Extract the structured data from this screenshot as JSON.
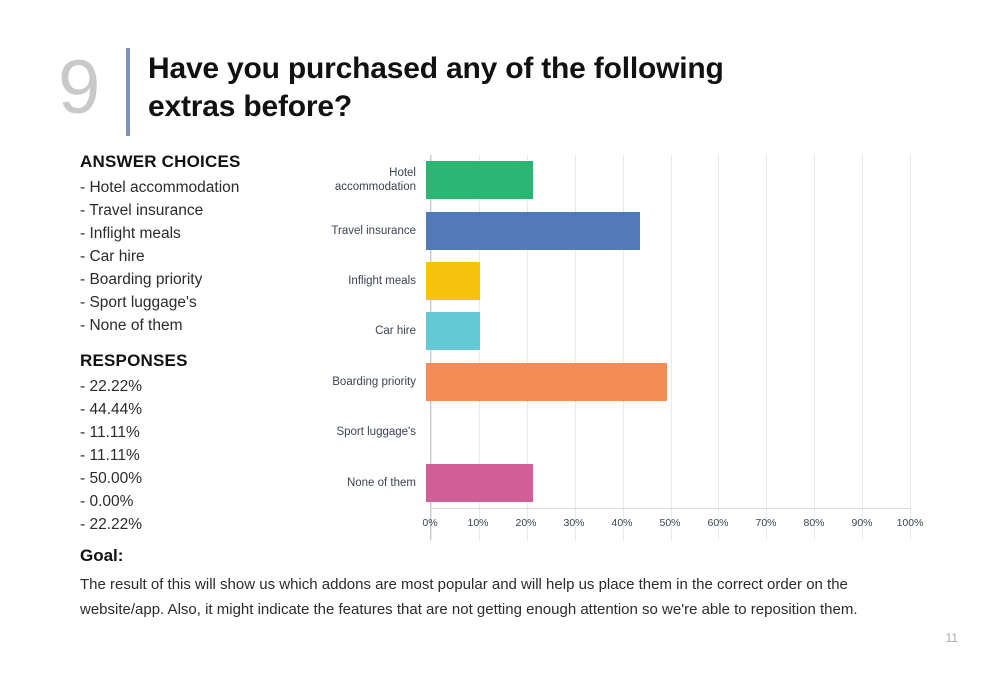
{
  "slide": {
    "number": "9",
    "title": "Have you purchased any of the following extras before?",
    "page_number": "11"
  },
  "answer_choices": {
    "heading": "ANSWER CHOICES",
    "items": [
      "- Hotel accommodation",
      "- Travel insurance",
      "- Inflight meals",
      "- Car hire",
      "- Boarding priority",
      "- Sport luggage's",
      "- None of them"
    ]
  },
  "responses": {
    "heading": "RESPONSES",
    "items": [
      "- 22.22%",
      "- 44.44%",
      "- 11.11%",
      "- 11.11%",
      "- 50.00%",
      "- 0.00%",
      "- 22.22%"
    ]
  },
  "goal": {
    "title": "Goal:",
    "text": "The result of this will show us which addons are most popular and will help us place them in the correct order on the website/app. Also, it might indicate the features that are not getting enough attention so we're able to reposition them."
  },
  "chart_data": {
    "type": "bar",
    "orientation": "horizontal",
    "title": "",
    "xlabel": "",
    "ylabel": "",
    "xlim": [
      0,
      100
    ],
    "grid": true,
    "legend": "none",
    "categories": [
      "Hotel accommodation",
      "Travel insurance",
      "Inflight meals",
      "Car hire",
      "Boarding priority",
      "Sport luggage's",
      "None of them"
    ],
    "values": [
      22.22,
      44.44,
      11.11,
      11.11,
      50.0,
      0.0,
      22.22
    ],
    "colors": [
      "#2bb673",
      "#5279b8",
      "#f8c20e",
      "#63c9d4",
      "#f58b55",
      "#f58b55",
      "#d15e97"
    ],
    "xticks": [
      "0%",
      "10%",
      "20%",
      "30%",
      "40%",
      "50%",
      "60%",
      "70%",
      "80%",
      "90%",
      "100%"
    ],
    "xtick_values": [
      0,
      10,
      20,
      30,
      40,
      50,
      60,
      70,
      80,
      90,
      100
    ]
  },
  "theme": {
    "accent_divider": "#7d93bd",
    "slide_number_color": "#c9c9c9",
    "grid_color": "#e7e9ec",
    "axis_color": "#c8ccd2"
  }
}
